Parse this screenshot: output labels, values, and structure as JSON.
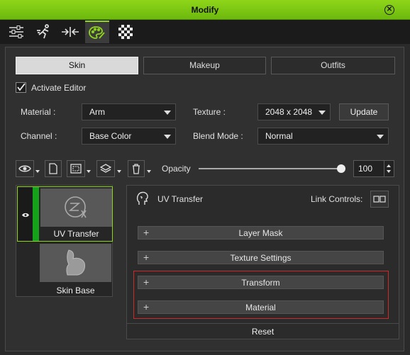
{
  "window": {
    "title": "Modify"
  },
  "toolbar": {
    "icons": [
      "sliders-icon",
      "motion-icon",
      "align-icon",
      "palette-icon",
      "checker-icon"
    ]
  },
  "tabs": [
    "Skin",
    "Makeup",
    "Outfits"
  ],
  "activate_editor": {
    "label": "Activate Editor",
    "checked": true
  },
  "material": {
    "label": "Material :",
    "value": "Arm"
  },
  "texture": {
    "label": "Texture :",
    "value": "2048 x 2048",
    "update_label": "Update"
  },
  "channel": {
    "label": "Channel :",
    "value": "Base Color"
  },
  "blend_mode": {
    "label": "Blend Mode :",
    "value": "Normal"
  },
  "opacity": {
    "label": "Opacity",
    "value": "100",
    "level": 1.0
  },
  "layers": [
    {
      "name": "UV Transfer",
      "visible": true,
      "selected": true
    },
    {
      "name": "Skin Base",
      "visible": false,
      "selected": false
    }
  ],
  "detail": {
    "title": "UV Transfer",
    "link_label": "Link Controls:",
    "sections": [
      "Layer Mask",
      "Texture Settings",
      "Transform",
      "Material"
    ],
    "reset_label": "Reset"
  },
  "colors": {
    "accent": "#8fd61a",
    "highlight": "#cc2a2a"
  }
}
